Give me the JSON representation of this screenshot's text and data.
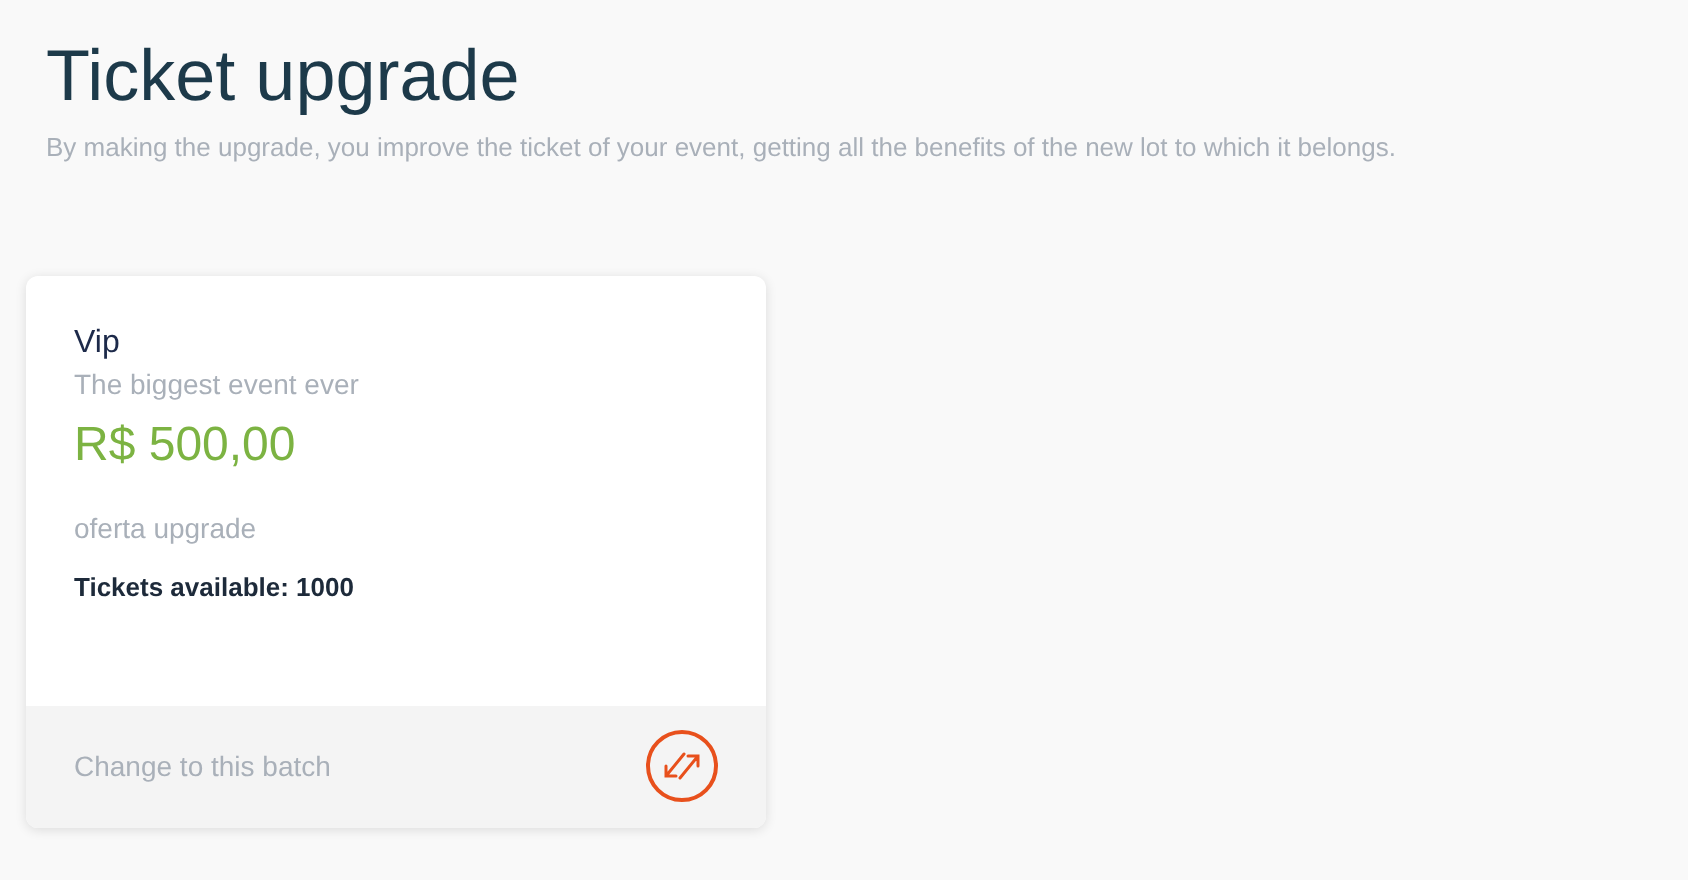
{
  "page": {
    "title": "Ticket upgrade",
    "subtitle": "By making the upgrade, you improve the ticket of your event, getting all the benefits of the new lot to which it belongs."
  },
  "lots": [
    {
      "name": "Vip",
      "description": "The biggest event ever",
      "price": "R$ 500,00",
      "offer": "oferta upgrade",
      "availability": "Tickets available: 1000",
      "action": "Change to this batch"
    }
  ]
}
